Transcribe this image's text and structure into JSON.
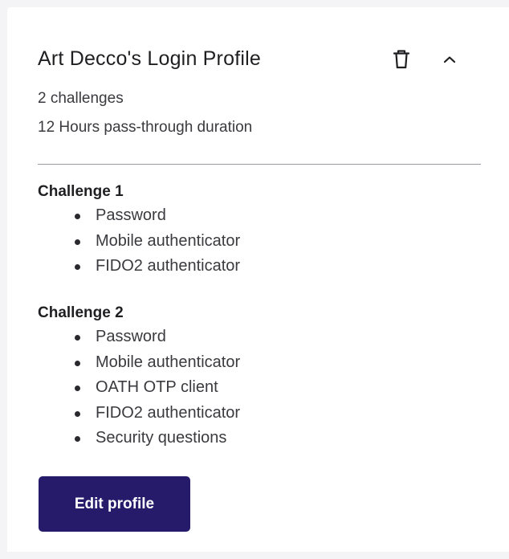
{
  "profile": {
    "title": "Art Decco's Login Profile",
    "challenge_count": "2 challenges",
    "pass_through": "12 Hours pass-through duration"
  },
  "actions": {
    "delete_icon": "trash-icon",
    "collapse_icon": "chevron-up-icon",
    "edit_label": "Edit profile"
  },
  "challenges": [
    {
      "title": "Challenge 1",
      "methods": [
        "Password",
        "Mobile authenticator",
        "FIDO2 authenticator"
      ]
    },
    {
      "title": "Challenge 2",
      "methods": [
        "Password",
        "Mobile authenticator",
        "OATH OTP client",
        "FIDO2 authenticator",
        "Security questions"
      ]
    }
  ],
  "colors": {
    "primary_button": "#261a6b",
    "text": "#1f1f22",
    "background": "#f4f4f6"
  }
}
